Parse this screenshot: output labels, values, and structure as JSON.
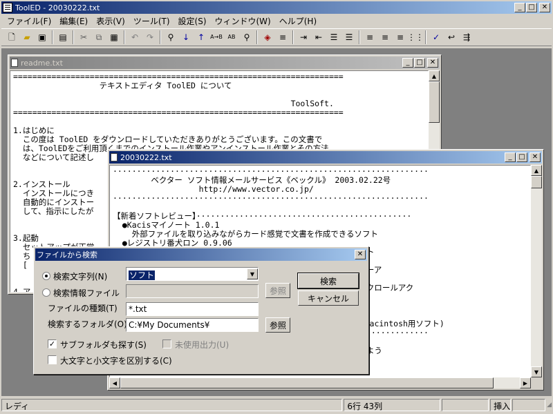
{
  "app": {
    "title": "ToolED - 20030222.txt"
  },
  "menu": [
    "ファイル(F)",
    "編集(E)",
    "表示(V)",
    "ツール(T)",
    "設定(S)",
    "ウィンドウ(W)",
    "ヘルプ(H)"
  ],
  "toolbar_icons": [
    "new-icon",
    "open-icon",
    "save-icon",
    "print-icon",
    "cut-icon",
    "copy-icon",
    "paste-icon",
    "undo-icon",
    "redo-icon",
    "find-icon",
    "find-next-icon",
    "find-prev-icon",
    "replace-icon",
    "replace-all-icon",
    "find-in-files-icon",
    "tag-icon",
    "list-icon",
    "indent-icon",
    "outdent-icon",
    "bullet-icon",
    "number-icon",
    "align-left-icon",
    "align-center-icon",
    "align-right-icon",
    "justify-icon",
    "spell-icon",
    "wrap-icon",
    "jump-icon"
  ],
  "readme": {
    "title": "readme.txt",
    "lines": [
      "=====================================================================",
      "                  テキストエディタ ToolED について",
      "",
      "                                                          ToolSoft.",
      "=====================================================================",
      "",
      "1.はじめに",
      "  この度は ToolED をダウンロードしていただきありがとうございます。この文書で",
      "  は、ToolEDをご利用頂くまでのインストール作業やアンインストール作業とその方法",
      "  などについて記述し",
      "",
      "",
      "2.インストール",
      "  インストールにつき",
      "  自動的にインストー",
      "  して、指示にしたが",
      "",
      "",
      "3.起動",
      "  セットアップが正常",
      "  ち",
      "  [",
      "",
      "",
      "4.ア"
    ]
  },
  "mail": {
    "title": "20030222.txt",
    "lines": [
      "··································································",
      "        ベクター ソフト情報メールサービス《ベックル》 2003.02.22号",
      "                  http://www.vector.co.jp/",
      "··································································",
      "",
      "【新着ソフトレビュー】·············································",
      "  ●Kacisマイノート 1.0.1",
      "    外部ファイルを取り込みながらカード感覚で文書を作成できるソフト",
      "  ●レジストリ番犬ロン 0.9.06",
      "                                                視ソフト",
      "",
      "                                                像ビューア",
      "",
      "                                                の横スクロールアク",
      "",
      "",
      "                                                ト",
      "                                                  ○はMacintosh用ソフト)",
      "··································································",
      "",
      "                                                見てみよう",
      "  ●"
    ]
  },
  "dialog": {
    "title": "ファイルから検索",
    "close": "✕",
    "search_string_label": "検索文字列(N)",
    "search_string_value": "ソフト",
    "search_info_label": "検索情報ファイル",
    "browse1": "参照",
    "file_type_label": "ファイルの種類(T)",
    "file_type_value": "*.txt",
    "folder_label": "検索するフォルダ(O)",
    "folder_value": "C:¥My Documents¥",
    "browse2": "参照",
    "search_button": "検索",
    "cancel_button": "キャンセル",
    "subfolder_label": "サブフォルダも探す(S)",
    "subfolder_checked": true,
    "unused_output_label": "未使用出力(U)",
    "unused_output_checked": false,
    "case_label": "大文字と小文字を区別する(C)",
    "case_checked": false
  },
  "status": {
    "ready": "レディ",
    "position": "6行 43列",
    "blank1": "",
    "mode": "挿入",
    "blank2": ""
  }
}
